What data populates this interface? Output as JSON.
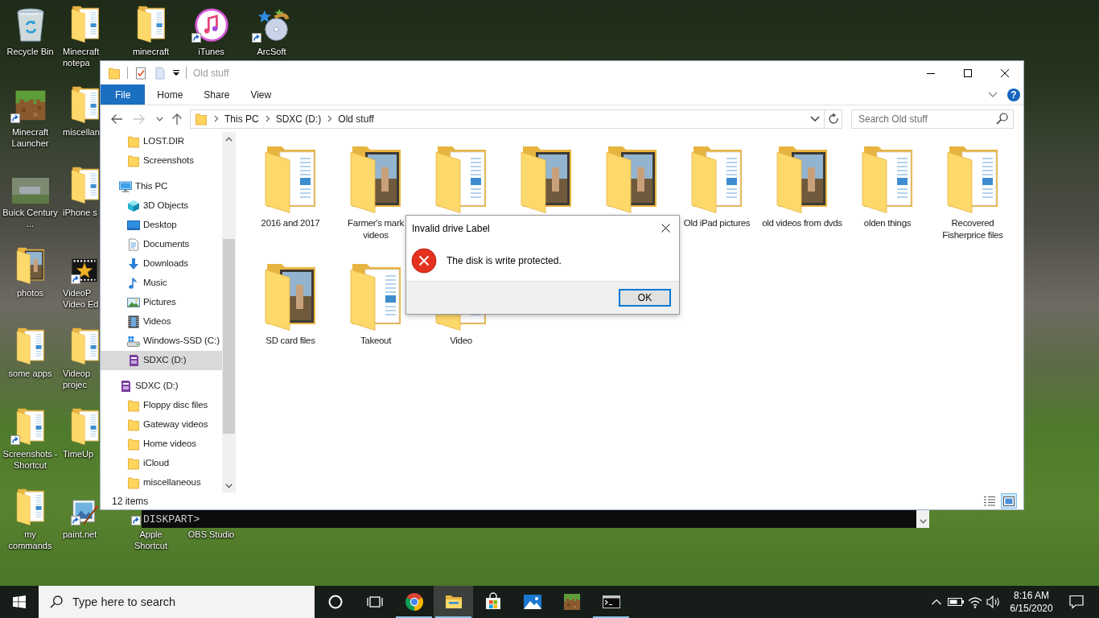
{
  "desktop_icons": {
    "columns": [
      [
        {
          "label": "Recycle Bin",
          "kind": "recycle",
          "shortcut": false
        },
        {
          "label": "Minecraft Launcher",
          "kind": "block",
          "shortcut": true
        },
        {
          "label": "Buick Century ...",
          "kind": "photo",
          "shortcut": false
        },
        {
          "label": "photos",
          "kind": "folder_photo",
          "shortcut": false
        },
        {
          "label": "some apps",
          "kind": "folder",
          "shortcut": false
        },
        {
          "label": "Screenshots - Shortcut",
          "kind": "folder",
          "shortcut": true
        },
        {
          "label": "my commands",
          "kind": "folder",
          "shortcut": false
        }
      ],
      [
        {
          "label": "Minecraft notepa",
          "kind": "folder",
          "shortcut": false
        },
        {
          "label": "miscellan",
          "kind": "folder",
          "shortcut": false
        },
        {
          "label": "iPhone s",
          "kind": "folder",
          "shortcut": false
        },
        {
          "label": "VideoP Video Ed",
          "kind": "star",
          "shortcut": true
        },
        {
          "label": "Videop projec",
          "kind": "folder",
          "shortcut": false
        },
        {
          "label": "TimeUp",
          "kind": "folder",
          "shortcut": false
        },
        {
          "label": "paint.net",
          "kind": "painting",
          "shortcut": true
        }
      ],
      [
        {
          "label": "minecraft",
          "kind": "folder",
          "shortcut": false
        },
        {
          "label": "Apple Shortcut",
          "shortcut": true
        }
      ],
      [
        {
          "label": "iTunes",
          "kind": "music",
          "shortcut": true
        },
        {
          "label": "OBS Studio",
          "shortcut": false
        }
      ],
      [
        {
          "label": "ArcSoft",
          "kind": "disc",
          "shortcut": true
        }
      ]
    ]
  },
  "explorer_window": {
    "title": "Old stuff",
    "ribbon_tabs": [
      {
        "label": "File",
        "kind": "menu"
      },
      {
        "label": "Home",
        "kind": "tab"
      },
      {
        "label": "Share",
        "kind": "tab"
      },
      {
        "label": "View",
        "kind": "tab"
      }
    ],
    "help": "?",
    "nav_buttons": [
      {
        "kind": "back",
        "disabled": false
      },
      {
        "kind": "forward",
        "disabled": true
      },
      {
        "kind": "recent",
        "disabled": false
      },
      {
        "kind": "up",
        "disabled": false
      }
    ],
    "breadcrumbs": [
      "This PC",
      "SDXC (D:)",
      "Old stuff"
    ],
    "search": {
      "placeholder": "Search Old stuff"
    },
    "nav_pane": {
      "continued_items": [
        {
          "label": "LOST.DIR",
          "kind": "folder",
          "selected": false
        },
        {
          "label": "Screenshots",
          "kind": "folder",
          "selected": false
        }
      ],
      "tree": [
        {
          "label": "This PC",
          "kind": "pc",
          "selected": false,
          "children": [
            {
              "label": "3D Objects",
              "kind": "objects",
              "selected": false
            },
            {
              "label": "Desktop",
              "kind": "desktop",
              "selected": false
            },
            {
              "label": "Documents",
              "kind": "documents",
              "selected": false
            },
            {
              "label": "Downloads",
              "kind": "downloads",
              "selected": false
            },
            {
              "label": "Music",
              "kind": "music",
              "selected": false
            },
            {
              "label": "Pictures",
              "kind": "pictures",
              "selected": false
            },
            {
              "label": "Videos",
              "kind": "videos",
              "selected": false
            },
            {
              "label": "Windows-SSD (C:)",
              "kind": "drive",
              "selected": false
            },
            {
              "label": "SDXC (D:)",
              "kind": "sdcard",
              "selected": true
            }
          ]
        },
        {
          "label": "SDXC (D:)",
          "kind": "sdcard",
          "selected": false,
          "children": [
            {
              "label": "Floppy disc files",
              "kind": "folder",
              "selected": false
            },
            {
              "label": "Gateway videos",
              "kind": "folder",
              "selected": false
            },
            {
              "label": "Home videos",
              "kind": "folder",
              "selected": false
            },
            {
              "label": "iCloud",
              "kind": "folder",
              "selected": false
            },
            {
              "label": "miscellaneous",
              "kind": "folder",
              "selected": false
            }
          ]
        }
      ]
    },
    "items": [
      {
        "label": "2016 and 2017",
        "kind": "pages"
      },
      {
        "label": "Farmer's mark videos",
        "kind": "photo"
      },
      {
        "kind": "pages"
      },
      {
        "kind": "photo"
      },
      {
        "kind": "photo"
      },
      {
        "label": "Old iPad pictures",
        "kind": "pages"
      },
      {
        "label": "old videos from dvds",
        "kind": "photo"
      },
      {
        "label": "olden things",
        "kind": "pages"
      },
      {
        "label": "Recovered Fisherprice files",
        "kind": "pages"
      },
      {
        "label": "SD card files",
        "kind": "photo"
      },
      {
        "label": "Takeout",
        "kind": "pages"
      },
      {
        "label": "Video",
        "kind": "pages"
      }
    ],
    "status_bar": {
      "count": "12 items",
      "view_buttons": [
        {
          "kind": "details",
          "selected": false
        },
        {
          "kind": "large_icons",
          "selected": true
        }
      ]
    }
  },
  "dialog": {
    "title": "Invalid drive Label",
    "kind": "error",
    "message": "The disk is write protected.",
    "buttons": [
      {
        "label": "OK",
        "focused": true
      }
    ]
  },
  "terminal_window": {
    "prompt": "DISKPART>"
  },
  "taskbar": {
    "search": {
      "placeholder": "Type here to search"
    },
    "buttons": [
      {
        "kind": "cortana",
        "open": false,
        "active": false
      },
      {
        "kind": "task_view",
        "open": false,
        "active": false
      },
      {
        "kind": "browser",
        "open": true,
        "active": false
      },
      {
        "kind": "explorer",
        "open": true,
        "active": true
      },
      {
        "kind": "store",
        "open": false,
        "active": false
      },
      {
        "kind": "photos",
        "open": false,
        "active": false
      },
      {
        "kind": "minecraft",
        "open": false,
        "active": false
      },
      {
        "kind": "terminal",
        "open": true,
        "active": false
      }
    ],
    "tray": {
      "time": "8:16 AM",
      "date": "6/15/2020"
    }
  }
}
